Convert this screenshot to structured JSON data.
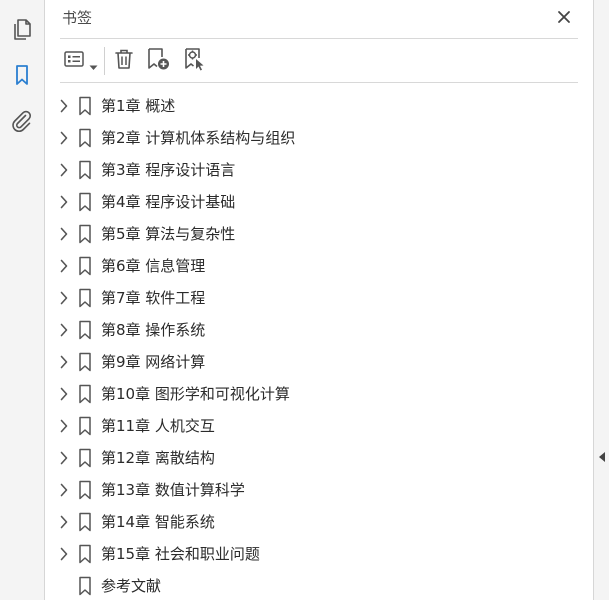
{
  "rail": {
    "items": [
      {
        "icon": "pages-icon"
      },
      {
        "icon": "bookmark-icon",
        "active": true
      },
      {
        "icon": "attachment-icon"
      }
    ]
  },
  "panel": {
    "title": "书签"
  },
  "colors": {
    "accent": "#2b7fd0",
    "icon_gray": "#555555",
    "text": "#2b2b2b"
  },
  "bookmarks": [
    {
      "label": "第1章 概述",
      "expandable": true
    },
    {
      "label": "第2章 计算机体系结构与组织",
      "expandable": true
    },
    {
      "label": "第3章 程序设计语言",
      "expandable": true
    },
    {
      "label": "第4章 程序设计基础",
      "expandable": true
    },
    {
      "label": "第5章 算法与复杂性",
      "expandable": true
    },
    {
      "label": "第6章 信息管理",
      "expandable": true
    },
    {
      "label": "第7章 软件工程",
      "expandable": true
    },
    {
      "label": "第8章 操作系统",
      "expandable": true
    },
    {
      "label": "第9章 网络计算",
      "expandable": true
    },
    {
      "label": "第10章 图形学和可视化计算",
      "expandable": true
    },
    {
      "label": "第11章 人机交互",
      "expandable": true
    },
    {
      "label": "第12章 离散结构",
      "expandable": true
    },
    {
      "label": "第13章 数值计算科学",
      "expandable": true
    },
    {
      "label": "第14章 智能系统",
      "expandable": true
    },
    {
      "label": "第15章 社会和职业问题",
      "expandable": true
    },
    {
      "label": "参考文献",
      "expandable": false
    }
  ]
}
